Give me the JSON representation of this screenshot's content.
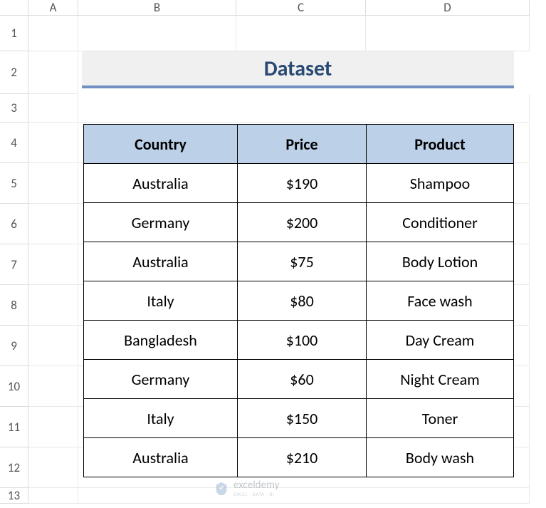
{
  "columns": [
    "A",
    "B",
    "C",
    "D"
  ],
  "rows": [
    "1",
    "2",
    "3",
    "4",
    "5",
    "6",
    "7",
    "8",
    "9",
    "10",
    "11",
    "12",
    "13"
  ],
  "title": "Dataset",
  "chart_data": {
    "type": "table",
    "headers": [
      "Country",
      "Price",
      "Product"
    ],
    "data": [
      [
        "Australia",
        "$190",
        "Shampoo"
      ],
      [
        "Germany",
        "$200",
        "Conditioner"
      ],
      [
        "Australia",
        "$75",
        "Body Lotion"
      ],
      [
        "Italy",
        "$80",
        "Face wash"
      ],
      [
        "Bangladesh",
        "$100",
        "Day Cream"
      ],
      [
        "Germany",
        "$60",
        "Night Cream"
      ],
      [
        "Italy",
        "$150",
        "Toner"
      ],
      [
        "Australia",
        "$210",
        "Body wash"
      ]
    ]
  },
  "watermark": {
    "name": "exceldemy",
    "sub": "EXCEL · DATA · BI"
  }
}
